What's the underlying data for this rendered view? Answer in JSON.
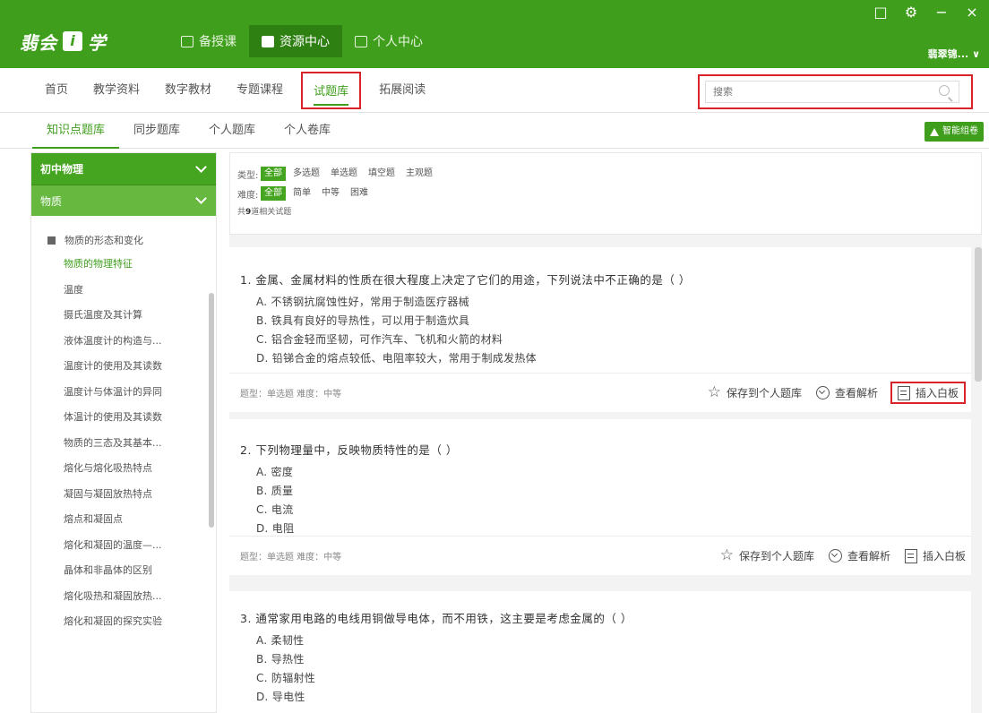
{
  "app": {
    "logo_part1": "翡会",
    "logo_box": "i",
    "logo_part2": "学",
    "user_name": "翡翠锦..."
  },
  "topnav": [
    {
      "label": "备授课",
      "active": false
    },
    {
      "label": "资源中心",
      "active": true
    },
    {
      "label": "个人中心",
      "active": false
    }
  ],
  "window_controls": {
    "restore": "□",
    "settings": "⚙",
    "minimize": "−",
    "close": "×",
    "user_chevron": "∨"
  },
  "subnav": {
    "tabs": [
      "首页",
      "教学资料",
      "数字教材",
      "专题课程",
      "试题库",
      "拓展阅读"
    ],
    "active_index": 4
  },
  "search": {
    "placeholder": "搜索"
  },
  "thirdnav": {
    "tabs": [
      "知识点题库",
      "同步题库",
      "个人题库",
      "个人卷库"
    ],
    "active_index": 0,
    "button_label": "智能组卷"
  },
  "sidebar": {
    "header": "初中物理",
    "subheader": "物质",
    "group": "物质的形态和变化",
    "items": [
      {
        "label": "物质的物理特征",
        "active": true
      },
      {
        "label": "温度",
        "active": false
      },
      {
        "label": "摄氏温度及其计算",
        "active": false
      },
      {
        "label": "液体温度计的构造与...",
        "active": false
      },
      {
        "label": "温度计的使用及其读数",
        "active": false
      },
      {
        "label": "温度计与体温计的异同",
        "active": false
      },
      {
        "label": "体温计的使用及其读数",
        "active": false
      },
      {
        "label": "物质的三态及其基本...",
        "active": false
      },
      {
        "label": "熔化与熔化吸热特点",
        "active": false
      },
      {
        "label": "凝固与凝固放热特点",
        "active": false
      },
      {
        "label": "熔点和凝固点",
        "active": false
      },
      {
        "label": "熔化和凝固的温度—...",
        "active": false
      },
      {
        "label": "晶体和非晶体的区别",
        "active": false
      },
      {
        "label": "熔化吸热和凝固放热...",
        "active": false
      },
      {
        "label": "熔化和凝固的探究实验",
        "active": false
      }
    ]
  },
  "filters": {
    "type_label": "类型:",
    "type_options": [
      "全部",
      "多选题",
      "单选题",
      "填空题",
      "主观题"
    ],
    "type_selected": 0,
    "difficulty_label": "难度:",
    "difficulty_options": [
      "全部",
      "简单",
      "中等",
      "困难"
    ],
    "difficulty_selected": 0,
    "count_prefix": "共",
    "count": "9",
    "count_suffix": "道相关试题"
  },
  "actions": {
    "save": "保存到个人题库",
    "analysis": "查看解析",
    "insert": "插入白板"
  },
  "questions": [
    {
      "title": "1. 金属、金属材料的性质在很大程度上决定了它们的用途，下列说法中不正确的是（     ）",
      "options": [
        "A. 不锈钢抗腐蚀性好，常用于制造医疗器械",
        "B. 铁具有良好的导热性，可以用于制造炊具",
        "C. 铝合金轻而坚韧，可作汽车、飞机和火箭的材料",
        "D. 铅锑合金的熔点较低、电阻率较大，常用于制成发热体"
      ],
      "meta": "题型：单选题    难度：中等"
    },
    {
      "title": "2. 下列物理量中，反映物质特性的是（     ）",
      "options": [
        "A. 密度",
        "B. 质量",
        "C. 电流",
        "D. 电阻"
      ],
      "meta": "题型：单选题    难度：中等"
    },
    {
      "title": "3. 通常家用电路的电线用铜做导电体，而不用铁，这主要是考虑金属的（     ）",
      "options": [
        "A. 柔韧性",
        "B. 导热性",
        "C. 防辐射性",
        "D. 导电性"
      ],
      "meta": ""
    }
  ]
}
